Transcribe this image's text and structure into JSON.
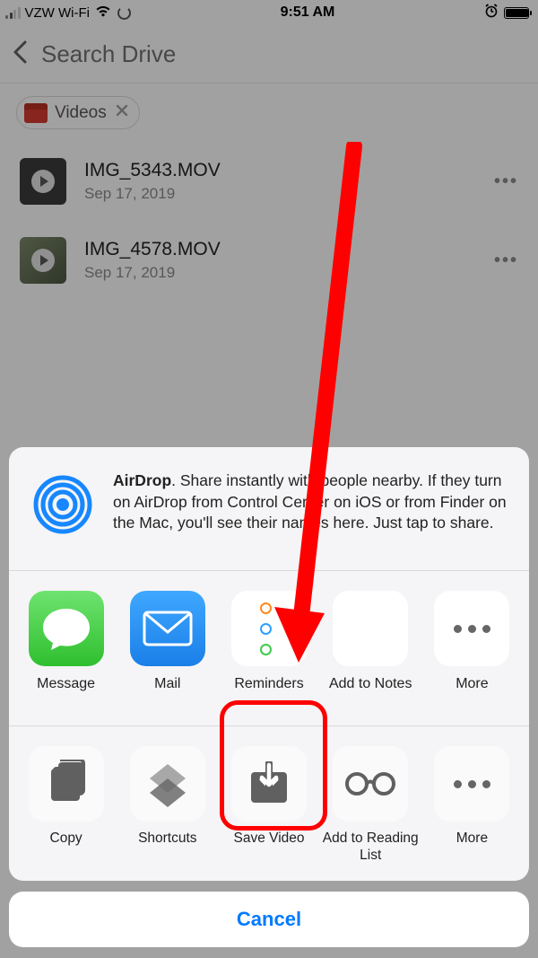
{
  "statusbar": {
    "carrier": "VZW Wi-Fi",
    "time": "9:51 AM"
  },
  "header": {
    "search_placeholder": "Search Drive"
  },
  "filter": {
    "chip_label": "Videos"
  },
  "files": [
    {
      "name": "IMG_5343.MOV",
      "date": "Sep 17, 2019"
    },
    {
      "name": "IMG_4578.MOV",
      "date": "Sep 17, 2019"
    }
  ],
  "airdrop": {
    "title": "AirDrop",
    "body": ". Share instantly with people nearby. If they turn on AirDrop from Control Center on iOS or from Finder on the Mac, you'll see their names here. Just tap to share."
  },
  "apps": {
    "message": "Message",
    "mail": "Mail",
    "reminders": "Reminders",
    "notes": "Add to Notes",
    "more": "More"
  },
  "actions": {
    "copy": "Copy",
    "shortcuts": "Shortcuts",
    "save_video": "Save Video",
    "reading_list": "Add to Reading List",
    "more": "More"
  },
  "cancel": "Cancel"
}
